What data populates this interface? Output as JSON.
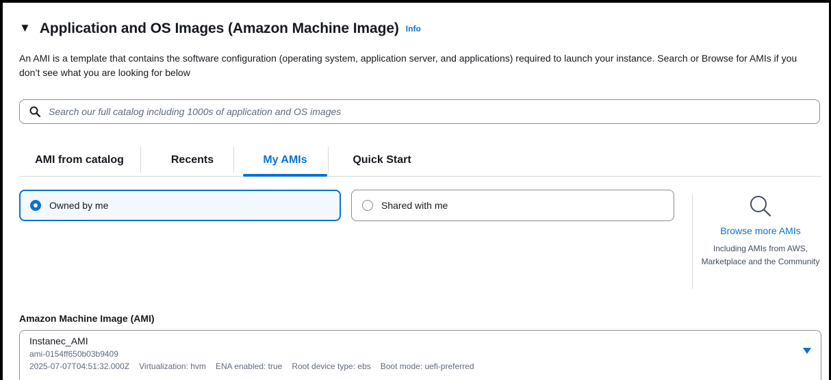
{
  "section": {
    "title": "Application and OS Images (Amazon Machine Image)",
    "info_link": "Info",
    "description": "An AMI is a template that contains the software configuration (operating system, application server, and applications) required to launch your instance. Search or Browse for AMIs if you don’t see what you are looking for below"
  },
  "search": {
    "placeholder": "Search our full catalog including 1000s of application and OS images",
    "value": ""
  },
  "tabs": [
    {
      "label": "AMI from catalog",
      "active": false
    },
    {
      "label": "Recents",
      "active": false
    },
    {
      "label": "My AMIs",
      "active": true
    },
    {
      "label": "Quick Start",
      "active": false
    }
  ],
  "ownership": {
    "options": [
      {
        "label": "Owned by me",
        "selected": true
      },
      {
        "label": "Shared with me",
        "selected": false
      }
    ]
  },
  "browse": {
    "link": "Browse more AMIs",
    "subtext": "Including AMIs from AWS, Marketplace and the Community"
  },
  "ami_select": {
    "label": "Amazon Machine Image (AMI)",
    "name": "Instanec_AMI",
    "id": "ami-0154ff650b03b9409",
    "created": "2025-07-07T04:51:32.000Z",
    "virtualization": "Virtualization: hvm",
    "ena": "ENA enabled: true",
    "root_device": "Root device type: ebs",
    "boot_mode": "Boot mode: uefi-preferred"
  },
  "colors": {
    "accent": "#0972d3",
    "text": "#16191f",
    "muted": "#5f6b7a",
    "border": "#8c8c94",
    "divider": "#d5dbdb"
  },
  "icons": [
    "expand-caret-icon",
    "search-icon",
    "radio-selected-icon",
    "radio-unselected-icon",
    "large-search-icon",
    "dropdown-caret-icon"
  ]
}
